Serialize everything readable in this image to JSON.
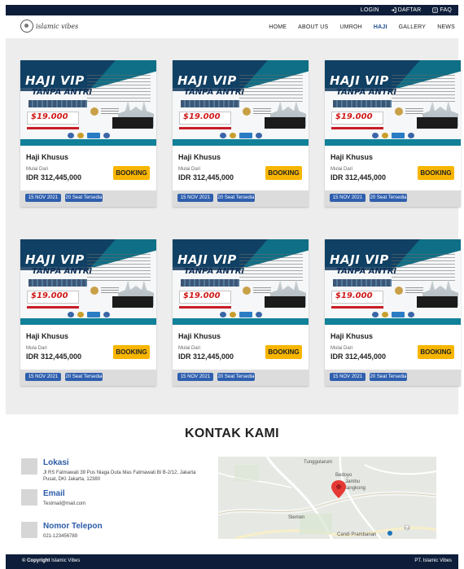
{
  "topbar": {
    "login": "LOGIN",
    "daftar": "DAFTAR",
    "faq": "FAQ"
  },
  "logo": {
    "text": "islamic vibes"
  },
  "nav": {
    "items": [
      "HOME",
      "ABOUT US",
      "UMROH",
      "HAJI",
      "GALLERY",
      "NEWS"
    ],
    "active": "HAJI"
  },
  "poster": {
    "headline": "HAJI VIP",
    "subheadline": "TANPA ANTRI",
    "price": "$19.000"
  },
  "cards": [
    {
      "title": "Haji Khusus",
      "mulai": "Mulai Dari",
      "price": "IDR 312,445,000",
      "booking": "BOOKING",
      "date": "15 NOV 2021",
      "seats": "20 Seat Tersedia"
    },
    {
      "title": "Haji Khusus",
      "mulai": "Mulai Dari",
      "price": "IDR 312,445,000",
      "booking": "BOOKING",
      "date": "15 NOV 2021",
      "seats": "20 Seat Tersedia"
    },
    {
      "title": "Haji Khusus",
      "mulai": "Mulai Dari",
      "price": "IDR 312,445,000",
      "booking": "BOOKING",
      "date": "15 NOV 2021",
      "seats": "20 Seat Tersedia"
    },
    {
      "title": "Haji Khusus",
      "mulai": "Mula Dari",
      "price": "IDR 312,445,000",
      "booking": "BOOKING",
      "date": "15 NOV 2021",
      "seats": "20 Seat Tersedia"
    },
    {
      "title": "Haji Khusus",
      "mulai": "Mulai Dari",
      "price": "IDR 312,445,000",
      "booking": "BOOKING",
      "date": "15 NOV 2021",
      "seats": "20 Seat Tersedia"
    },
    {
      "title": "Haji Khusus",
      "mulai": "Mulai Dari",
      "price": "IDR 312,445,000",
      "booking": "BOOKING",
      "date": "15 NOV 2021",
      "seats": "20 Seat Tersedia"
    }
  ],
  "contact": {
    "title": "KONTAK KAMI",
    "lokasi_label": "Lokasi",
    "lokasi_value": "Jl RS Fatmawati 39 Pus Niaga Duta Mas Fatmawati Bl B-2/12, Jakarta Pusat, DKI Jakarta, 12380",
    "email_label": "Email",
    "email_value": "Testmail@mail.com",
    "phone_label": "Nomor Telepon",
    "phone_value": "021-123456789"
  },
  "map": {
    "labels": [
      "Tunggularum",
      "Bedoyo",
      "Jambu",
      "Sangkong",
      "Slemen",
      "Candi Prambanan"
    ],
    "road_number": "715"
  },
  "footer": {
    "copyright_prefix": "© Copyright",
    "copyright_name": "Islamic Vibes",
    "right": "PT. Islamic Vibes"
  },
  "colors": {
    "navy": "#0e1e3a",
    "accent_blue": "#2b5ba8",
    "booking_yellow": "#f7b500",
    "chip_blue": "#2f5fae"
  }
}
